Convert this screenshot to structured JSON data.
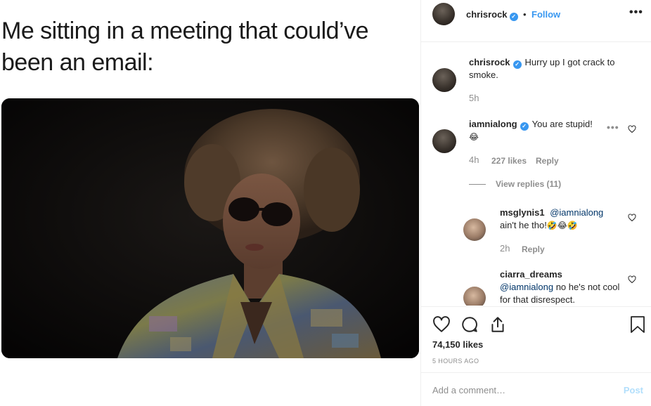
{
  "media": {
    "caption": "Me sitting in a meeting that could’ve been an email:"
  },
  "header": {
    "username": "chrisrock",
    "verified": true,
    "separator": "•",
    "follow_label": "Follow",
    "more_label": "•••"
  },
  "comments": [
    {
      "username": "chrisrock",
      "verified": true,
      "text": "Hurry up I got crack to smoke.",
      "time": "5h",
      "kind": "caption"
    },
    {
      "username": "iamnialong",
      "verified": true,
      "text": "You are stupid!",
      "emoji": "😂",
      "time": "4h",
      "likes": "227 likes",
      "reply_label": "Reply",
      "more_label": "•••",
      "view_replies": "View replies (11)"
    },
    {
      "username": "msglynis1",
      "mention": "@iamnialong",
      "text": "ain't he tho!",
      "emoji": "🤣😂🤣",
      "time": "2h",
      "reply_label": "Reply"
    },
    {
      "username": "ciarra_dreams",
      "mention": "@iamnialong",
      "text": "no he's not cool for that disrespect."
    }
  ],
  "actions": {
    "likes": "74,150 likes",
    "time_ago": "5 HOURS AGO"
  },
  "add_comment": {
    "placeholder": "Add a comment…",
    "post_label": "Post"
  },
  "colors": {
    "accent": "#3897f0",
    "post_disabled": "#b2dffc",
    "muted": "#8e8e8e",
    "text": "#262626"
  }
}
